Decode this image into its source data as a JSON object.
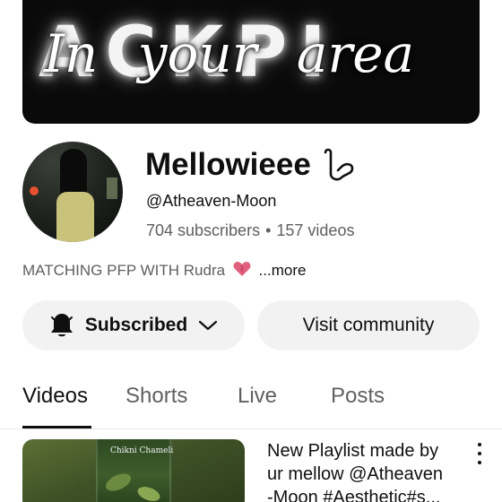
{
  "banner": {
    "block_text": "ACKPI",
    "script_text": "In your area",
    "script_prefix": "I"
  },
  "channel": {
    "name": "Mellowieee",
    "handle": "@Atheaven-Moon",
    "subscribers": "704 subscribers",
    "separator": "•",
    "videos": "157 videos",
    "description": "MATCHING PFP WITH Rudra",
    "more_label": "...more"
  },
  "buttons": {
    "subscribed_label": "Subscribed",
    "visit_community_label": "Visit community"
  },
  "tabs": [
    {
      "label": "Videos",
      "active": true
    },
    {
      "label": "Shorts",
      "active": false
    },
    {
      "label": "Live",
      "active": false
    },
    {
      "label": "Posts",
      "active": false
    }
  ],
  "video": {
    "thumbnail_caption": "Chikni Chameli",
    "title_lines": [
      "New Playlist made by",
      "ur mellow @Atheaven",
      "-Moon #Aesthetic#s..."
    ]
  },
  "colors": {
    "primary_text": "#0f0f0f",
    "secondary_text": "#606060",
    "button_bg": "#f2f2f2",
    "heart": "#e0607e"
  },
  "icons": {
    "name_badge": "hand-emoji-icon",
    "heart": "heart-emoji-icon",
    "bell": "bell-filled-icon",
    "chevron": "chevron-down-icon",
    "menu": "more-vert-icon"
  }
}
